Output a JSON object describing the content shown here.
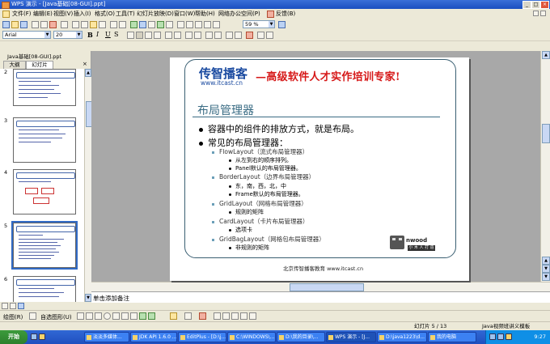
{
  "window": {
    "title": "WPS 演示 - [Java基础[08-GUI].ppt]"
  },
  "menubar": {
    "items": [
      "文件(F)",
      "编辑(E)",
      "视图(V)",
      "插入(I)",
      "格式(O)",
      "工具(T)",
      "幻灯片放映(D)",
      "窗口(W)",
      "帮助(H)",
      "网络办公空间(P)",
      "反馈(B)"
    ]
  },
  "toolbar": {
    "zoom": "59 %"
  },
  "format_bar": {
    "font": "Arial",
    "size": "20",
    "bold": "B",
    "italic": "I",
    "underline": "U",
    "shadow": "S"
  },
  "left_panel": {
    "doc_tab": "Java基础[08-GUI].ppt",
    "tabs": [
      "大纲",
      "幻灯片"
    ],
    "thumbnail_numbers": [
      "2",
      "3",
      "4",
      "5",
      "6"
    ]
  },
  "slide": {
    "logo_main": "传智播客",
    "logo_url": "www.itcast.cn",
    "slogan": "—高级软件人才实作培训专家!",
    "headline": "布局管理器",
    "bullets": [
      {
        "text": "容器中的组件的排放方式，就是布局。"
      },
      {
        "text": "常见的布局管理器："
      }
    ],
    "sub": [
      {
        "text": "FlowLayout（流式布局管理器）",
        "items": [
          "从左到右的顺序排列。",
          "Panel默认的布局管理器。"
        ]
      },
      {
        "text": "BorderLayout（边界布局管理器）",
        "items": [
          "东，南，西，北，中",
          "Frame默认的布局管理器。"
        ]
      },
      {
        "text": "GridLayout（网格布局管理器）",
        "items": [
          "规则的矩阵"
        ]
      },
      {
        "text": "CardLayout（卡片布局管理器）",
        "items": [
          "选项卡"
        ]
      },
      {
        "text": "GridBagLayout（网格包布局管理器）",
        "items": [
          "非规则的矩阵"
        ]
      }
    ],
    "badge_text": "nwood",
    "badge_small": "小 木 人 打 造",
    "footer": "北京传智播客教育 www.itcast.cn"
  },
  "notes": {
    "placeholder": "单击添加备注"
  },
  "drawbar": {
    "draw": "绘图(R)",
    "autoshapes": "自选图形(U)"
  },
  "status": {
    "slide_pos": "幻灯片 5 / 13",
    "template": "Java视频班讲义模板"
  },
  "taskbar": {
    "start": "开始",
    "tasks": [
      "淡淡多媒体...",
      "JDK API 1.6.0 ...",
      "EditPlus - [D:\\j...",
      "C:\\WINDOWS\\...",
      "D:\\我的目录\\...",
      "WPS 演示 - [J...",
      "D:\\java1223\\d...",
      "我的电脑"
    ],
    "clock": "9:27"
  }
}
